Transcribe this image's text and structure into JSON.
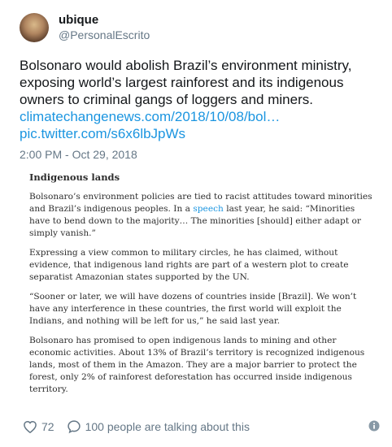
{
  "user": {
    "display_name": "ubique",
    "handle": "@PersonalEscrito"
  },
  "tweet": {
    "text": "Bolsonaro would abolish Brazil’s environment ministry, exposing world’s largest rainforest and its indigenous owners to criminal gangs of loggers and miners.",
    "link1": "climatechangenews.com/2018/10/08/bol…",
    "link2": "pic.twitter.com/s6x6lbJpWs",
    "timestamp": "2:00 PM - Oct 29, 2018"
  },
  "article": {
    "heading": "Indigenous lands",
    "p1_pre": "Bolsonaro’s environment policies are tied to racist attitudes toward minorities and Brazil’s indigenous peoples. In a ",
    "p1_link": "speech",
    "p1_post": " last year, he said: “Minorities have to bend down to the majority… The minorities [should] either adapt or simply vanish.”",
    "p2": "Expressing a view common to military circles, he has claimed, without evidence, that indigenous land rights are part of a western plot to create separatist Amazonian states supported by the UN.",
    "p3": "“Sooner or later, we will have dozens of countries inside [Brazil]. We won’t have any interference in these countries, the first world will exploit the Indians, and nothing will be left for us,” he said last year.",
    "p4": "Bolsonaro has promised to open indigenous lands to mining and other economic activities. About 13% of Brazil’s territory is recognized indigenous lands, most of them in the Amazon. They are a major barrier to protect the forest, only 2% of rainforest deforestation has occurred inside indigenous territory."
  },
  "footer": {
    "likes": "72",
    "replies": "100 people are talking about this"
  },
  "icons": {
    "heart": "heart-icon",
    "reply": "reply-bubble-icon",
    "info": "info-icon"
  },
  "colors": {
    "link": "#1b95e0",
    "muted": "#657786",
    "text": "#14171a"
  }
}
